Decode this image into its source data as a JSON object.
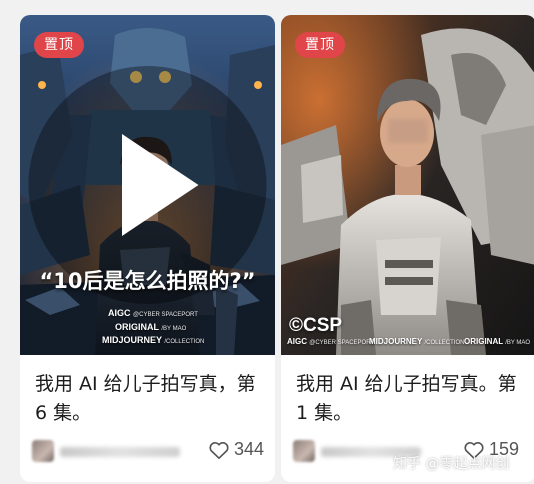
{
  "cards": [
    {
      "pin_badge": "置顶",
      "cover_quote": "“10后是怎么拍照的?”",
      "cover_lines": [
        {
          "text": "AIGC",
          "sub": "@CYBER SPACEPORT"
        },
        {
          "text": "ORIGINAL",
          "sub": "/BY MAO"
        },
        {
          "text": "MIDJOURNEY",
          "sub": "/COLLECTION"
        }
      ],
      "title": "我用 AI 给儿子拍写真，第 6 集。",
      "likes": "344",
      "icons": {
        "video": "video-play-icon",
        "like": "heart-outline-icon"
      }
    },
    {
      "pin_badge": "置顶",
      "cover_logo": "©CSP",
      "cover_lines": [
        {
          "text": "AIGC",
          "sub": "@CYBER SPACEPORT"
        },
        {
          "text": "MIDJOURNEY",
          "sub": "/COLLECTION"
        },
        {
          "text": "ORIGINAL",
          "sub": "/BY MAO"
        }
      ],
      "title": "我用 AI 给儿子拍写真。第 1 集。",
      "likes": "159",
      "icons": {
        "like": "heart-outline-icon"
      }
    }
  ],
  "watermark": "知乎 @零起点网创",
  "colors": {
    "page_bg": "#f1f1f1",
    "card_bg": "#ffffff",
    "pin_badge": "#e0454a",
    "title_text": "#1d1d1d",
    "meta_text": "#555555"
  }
}
